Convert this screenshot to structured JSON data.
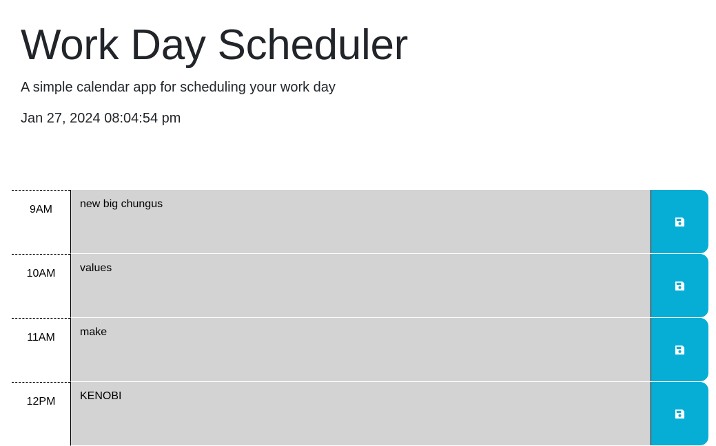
{
  "header": {
    "title": "Work Day Scheduler",
    "subtitle": "A simple calendar app for scheduling your work day",
    "current_day": "Jan 27, 2024 08:04:54 pm"
  },
  "colors": {
    "save_button": "#06aed5",
    "row_background": "#d3d3d3"
  },
  "save_icon": "floppy-disk-icon",
  "time_blocks": [
    {
      "hour": "9AM",
      "text": "new big chungus"
    },
    {
      "hour": "10AM",
      "text": "values"
    },
    {
      "hour": "11AM",
      "text": "make"
    },
    {
      "hour": "12PM",
      "text": "KENOBI"
    }
  ]
}
